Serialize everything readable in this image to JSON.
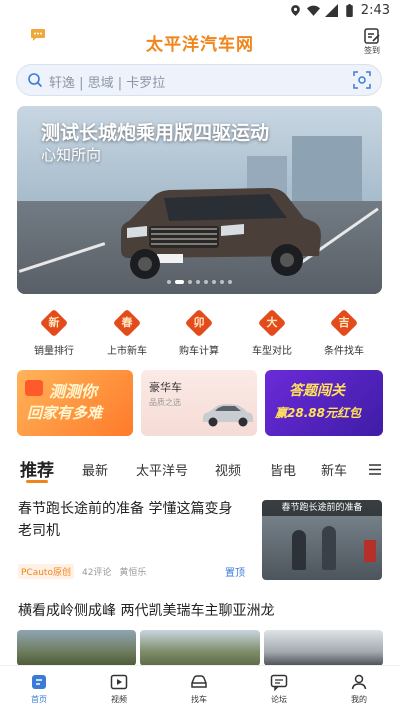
{
  "status_bar": {
    "time": "2:43"
  },
  "header": {
    "brand": "太平洋汽车网",
    "signin_label": "签到"
  },
  "search": {
    "placeholder": "轩逸 | 思域 | 卡罗拉"
  },
  "banner": {
    "title": "测试长城炮乘用版四驱运动",
    "subtitle": "心知所向",
    "slide_count": 8,
    "active_slide": 2
  },
  "quick_links": [
    {
      "label": "销量排行",
      "char": "新"
    },
    {
      "label": "上市新车",
      "char": "春"
    },
    {
      "label": "购车计算",
      "char": "卯"
    },
    {
      "label": "车型对比",
      "char": "大"
    },
    {
      "label": "条件找车",
      "char": "吉"
    }
  ],
  "promos": {
    "p1_line1": "测测你",
    "p1_line2": "回家有多难",
    "p2_title": "豪华车",
    "p2_sub": "品质之选",
    "p3_line1": "答题闯关",
    "p3_line2": "赢28.88元红包"
  },
  "tabs": [
    "推荐",
    "最新",
    "太平洋号",
    "视频",
    "皆电",
    "新车"
  ],
  "articles": [
    {
      "title": "春节跑长途前的准备 学懂这篇变身老司机",
      "source": "PCauto原创",
      "comments": "42评论",
      "author": "黄恒乐",
      "pin": "置顶",
      "thumb_caption": "春节跑长途前的准备"
    },
    {
      "title": "横看成岭侧成峰 两代凯美瑞车主聊亚洲龙"
    }
  ],
  "bottom_nav": [
    {
      "label": "首页",
      "icon": "home-icon"
    },
    {
      "label": "视频",
      "icon": "video-icon"
    },
    {
      "label": "找车",
      "icon": "car-icon"
    },
    {
      "label": "论坛",
      "icon": "forum-icon"
    },
    {
      "label": "我的",
      "icon": "profile-icon"
    }
  ],
  "colors": {
    "brand": "#f0851c",
    "accent": "#3b7bd8",
    "red": "#e34a1c"
  }
}
